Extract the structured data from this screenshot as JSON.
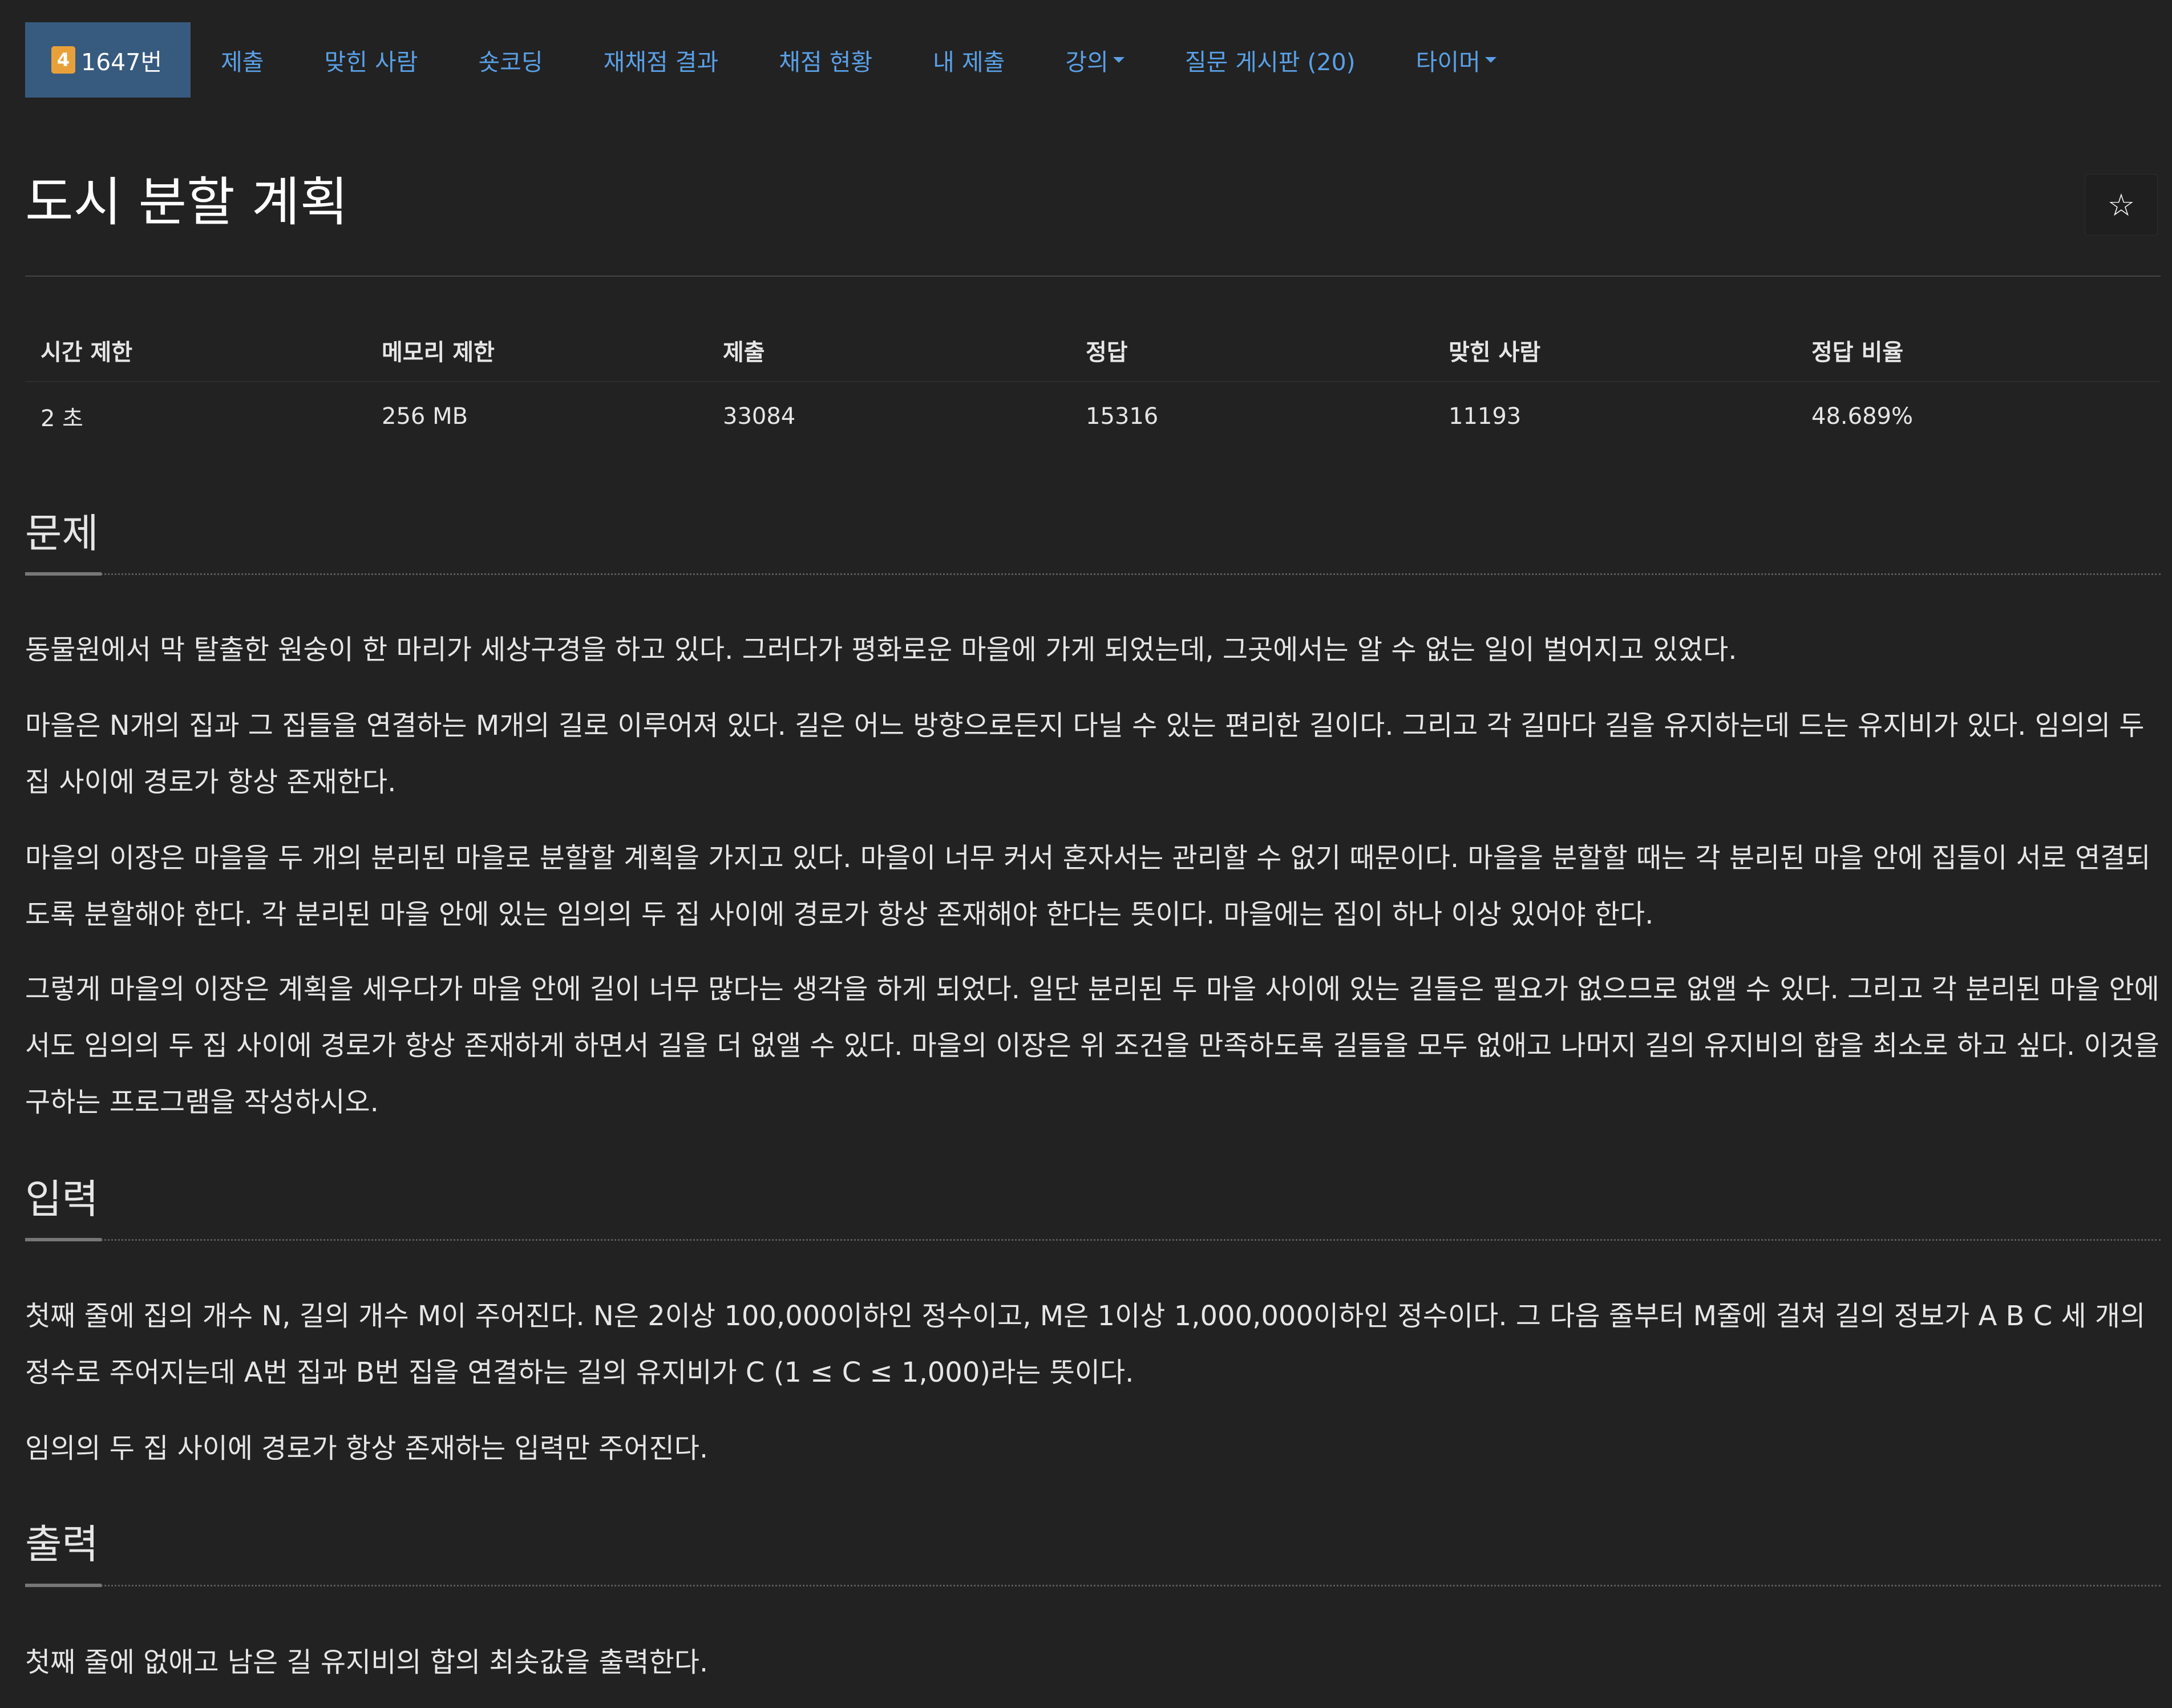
{
  "nav": {
    "problem_tier": "4",
    "problem_number": "1647번",
    "items": [
      {
        "label": "제출"
      },
      {
        "label": "맞힌 사람"
      },
      {
        "label": "숏코딩"
      },
      {
        "label": "재채점 결과"
      },
      {
        "label": "채점 현황"
      },
      {
        "label": "내 제출"
      },
      {
        "label": "강의"
      },
      {
        "label": "질문 게시판 (20)"
      },
      {
        "label": "타이머"
      }
    ]
  },
  "title": "도시 분할 계획",
  "star_icon": "☆",
  "stats": {
    "headers": [
      "시간 제한",
      "메모리 제한",
      "제출",
      "정답",
      "맞힌 사람",
      "정답 비율"
    ],
    "values": [
      "2 초",
      "256 MB",
      "33084",
      "15316",
      "11193",
      "48.689%"
    ]
  },
  "sections": {
    "problem": {
      "heading": "문제",
      "paragraphs": [
        "동물원에서 막 탈출한 원숭이 한 마리가 세상구경을 하고 있다. 그러다가 평화로운 마을에 가게 되었는데, 그곳에서는 알 수 없는 일이 벌어지고 있었다.",
        "마을은 N개의 집과 그 집들을 연결하는 M개의 길로 이루어져 있다. 길은 어느 방향으로든지 다닐 수 있는 편리한 길이다. 그리고 각 길마다 길을 유지하는데 드는 유지비가 있다. 임의의 두 집 사이에 경로가 항상 존재한다.",
        "마을의 이장은 마을을 두 개의 분리된 마을로 분할할 계획을 가지고 있다. 마을이 너무 커서 혼자서는 관리할 수 없기 때문이다. 마을을 분할할 때는 각 분리된 마을 안에 집들이 서로 연결되도록 분할해야 한다. 각 분리된 마을 안에 있는 임의의 두 집 사이에 경로가 항상 존재해야 한다는 뜻이다. 마을에는 집이 하나 이상 있어야 한다.",
        "그렇게 마을의 이장은 계획을 세우다가 마을 안에 길이 너무 많다는 생각을 하게 되었다. 일단 분리된 두 마을 사이에 있는 길들은 필요가 없으므로 없앨 수 있다. 그리고 각 분리된 마을 안에서도 임의의 두 집 사이에 경로가 항상 존재하게 하면서 길을 더 없앨 수 있다. 마을의 이장은 위 조건을 만족하도록 길들을 모두 없애고 나머지 길의 유지비의 합을 최소로 하고 싶다. 이것을 구하는 프로그램을 작성하시오."
      ]
    },
    "input": {
      "heading": "입력",
      "paragraphs": [
        "첫째 줄에 집의 개수 N, 길의 개수 M이 주어진다. N은 2이상 100,000이하인 정수이고, M은 1이상 1,000,000이하인 정수이다. 그 다음 줄부터 M줄에 걸쳐 길의 정보가 A B C 세 개의 정수로 주어지는데 A번 집과 B번 집을 연결하는 길의 유지비가 C (1 ≤ C ≤ 1,000)라는 뜻이다.",
        "임의의 두 집 사이에 경로가 항상 존재하는 입력만 주어진다."
      ]
    },
    "output": {
      "heading": "출력",
      "paragraphs": [
        "첫째 줄에 없애고 남은 길 유지비의 합의 최솟값을 출력한다."
      ]
    }
  }
}
